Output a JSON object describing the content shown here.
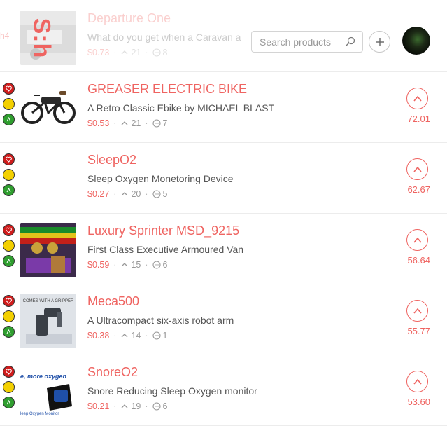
{
  "header": {
    "logo_text": "S:h",
    "edge_text": "h4",
    "search_placeholder": "Search products",
    "add_label": "+"
  },
  "colors": {
    "accent": "#ef6461",
    "light_red": "#d01c1c",
    "light_yellow": "#f3d000",
    "light_green": "#2f9e2f"
  },
  "products": [
    {
      "title": "Departure One",
      "tagline": "What do you get when a Caravan a",
      "price": "$0.73",
      "upvotes": "21",
      "comments": "8",
      "score": "",
      "thumb": "caravan"
    },
    {
      "title": "GREASER ELECTRIC BIKE",
      "tagline": "A Retro Classic Ebike by MICHAEL BLAST",
      "price": "$0.53",
      "upvotes": "21",
      "comments": "7",
      "score": "72.01",
      "thumb": "bike"
    },
    {
      "title": "SleepO2",
      "tagline": "Sleep Oxygen Monetoring Device",
      "price": "$0.27",
      "upvotes": "20",
      "comments": "5",
      "score": "62.67",
      "thumb": "none"
    },
    {
      "title": "Luxury Sprinter MSD_9215",
      "tagline": "First Class Executive Armoured Van",
      "price": "$0.59",
      "upvotes": "15",
      "comments": "6",
      "score": "56.64",
      "thumb": "van"
    },
    {
      "title": "Meca500",
      "tagline": "A Ultracompact six-axis robot arm",
      "price": "$0.38",
      "upvotes": "14",
      "comments": "1",
      "score": "55.77",
      "thumb": "robot",
      "thumb_caption": "COMES WITH A GRIPPER"
    },
    {
      "title": "SnoreO2",
      "tagline": "Snore Reducing Sleep Oxygen monitor",
      "price": "$0.21",
      "upvotes": "19",
      "comments": "6",
      "score": "53.60",
      "thumb": "snore",
      "thumb_caption_top": "e, more oxygen",
      "thumb_caption_bottom": "leep Oxygen Monitor"
    }
  ]
}
